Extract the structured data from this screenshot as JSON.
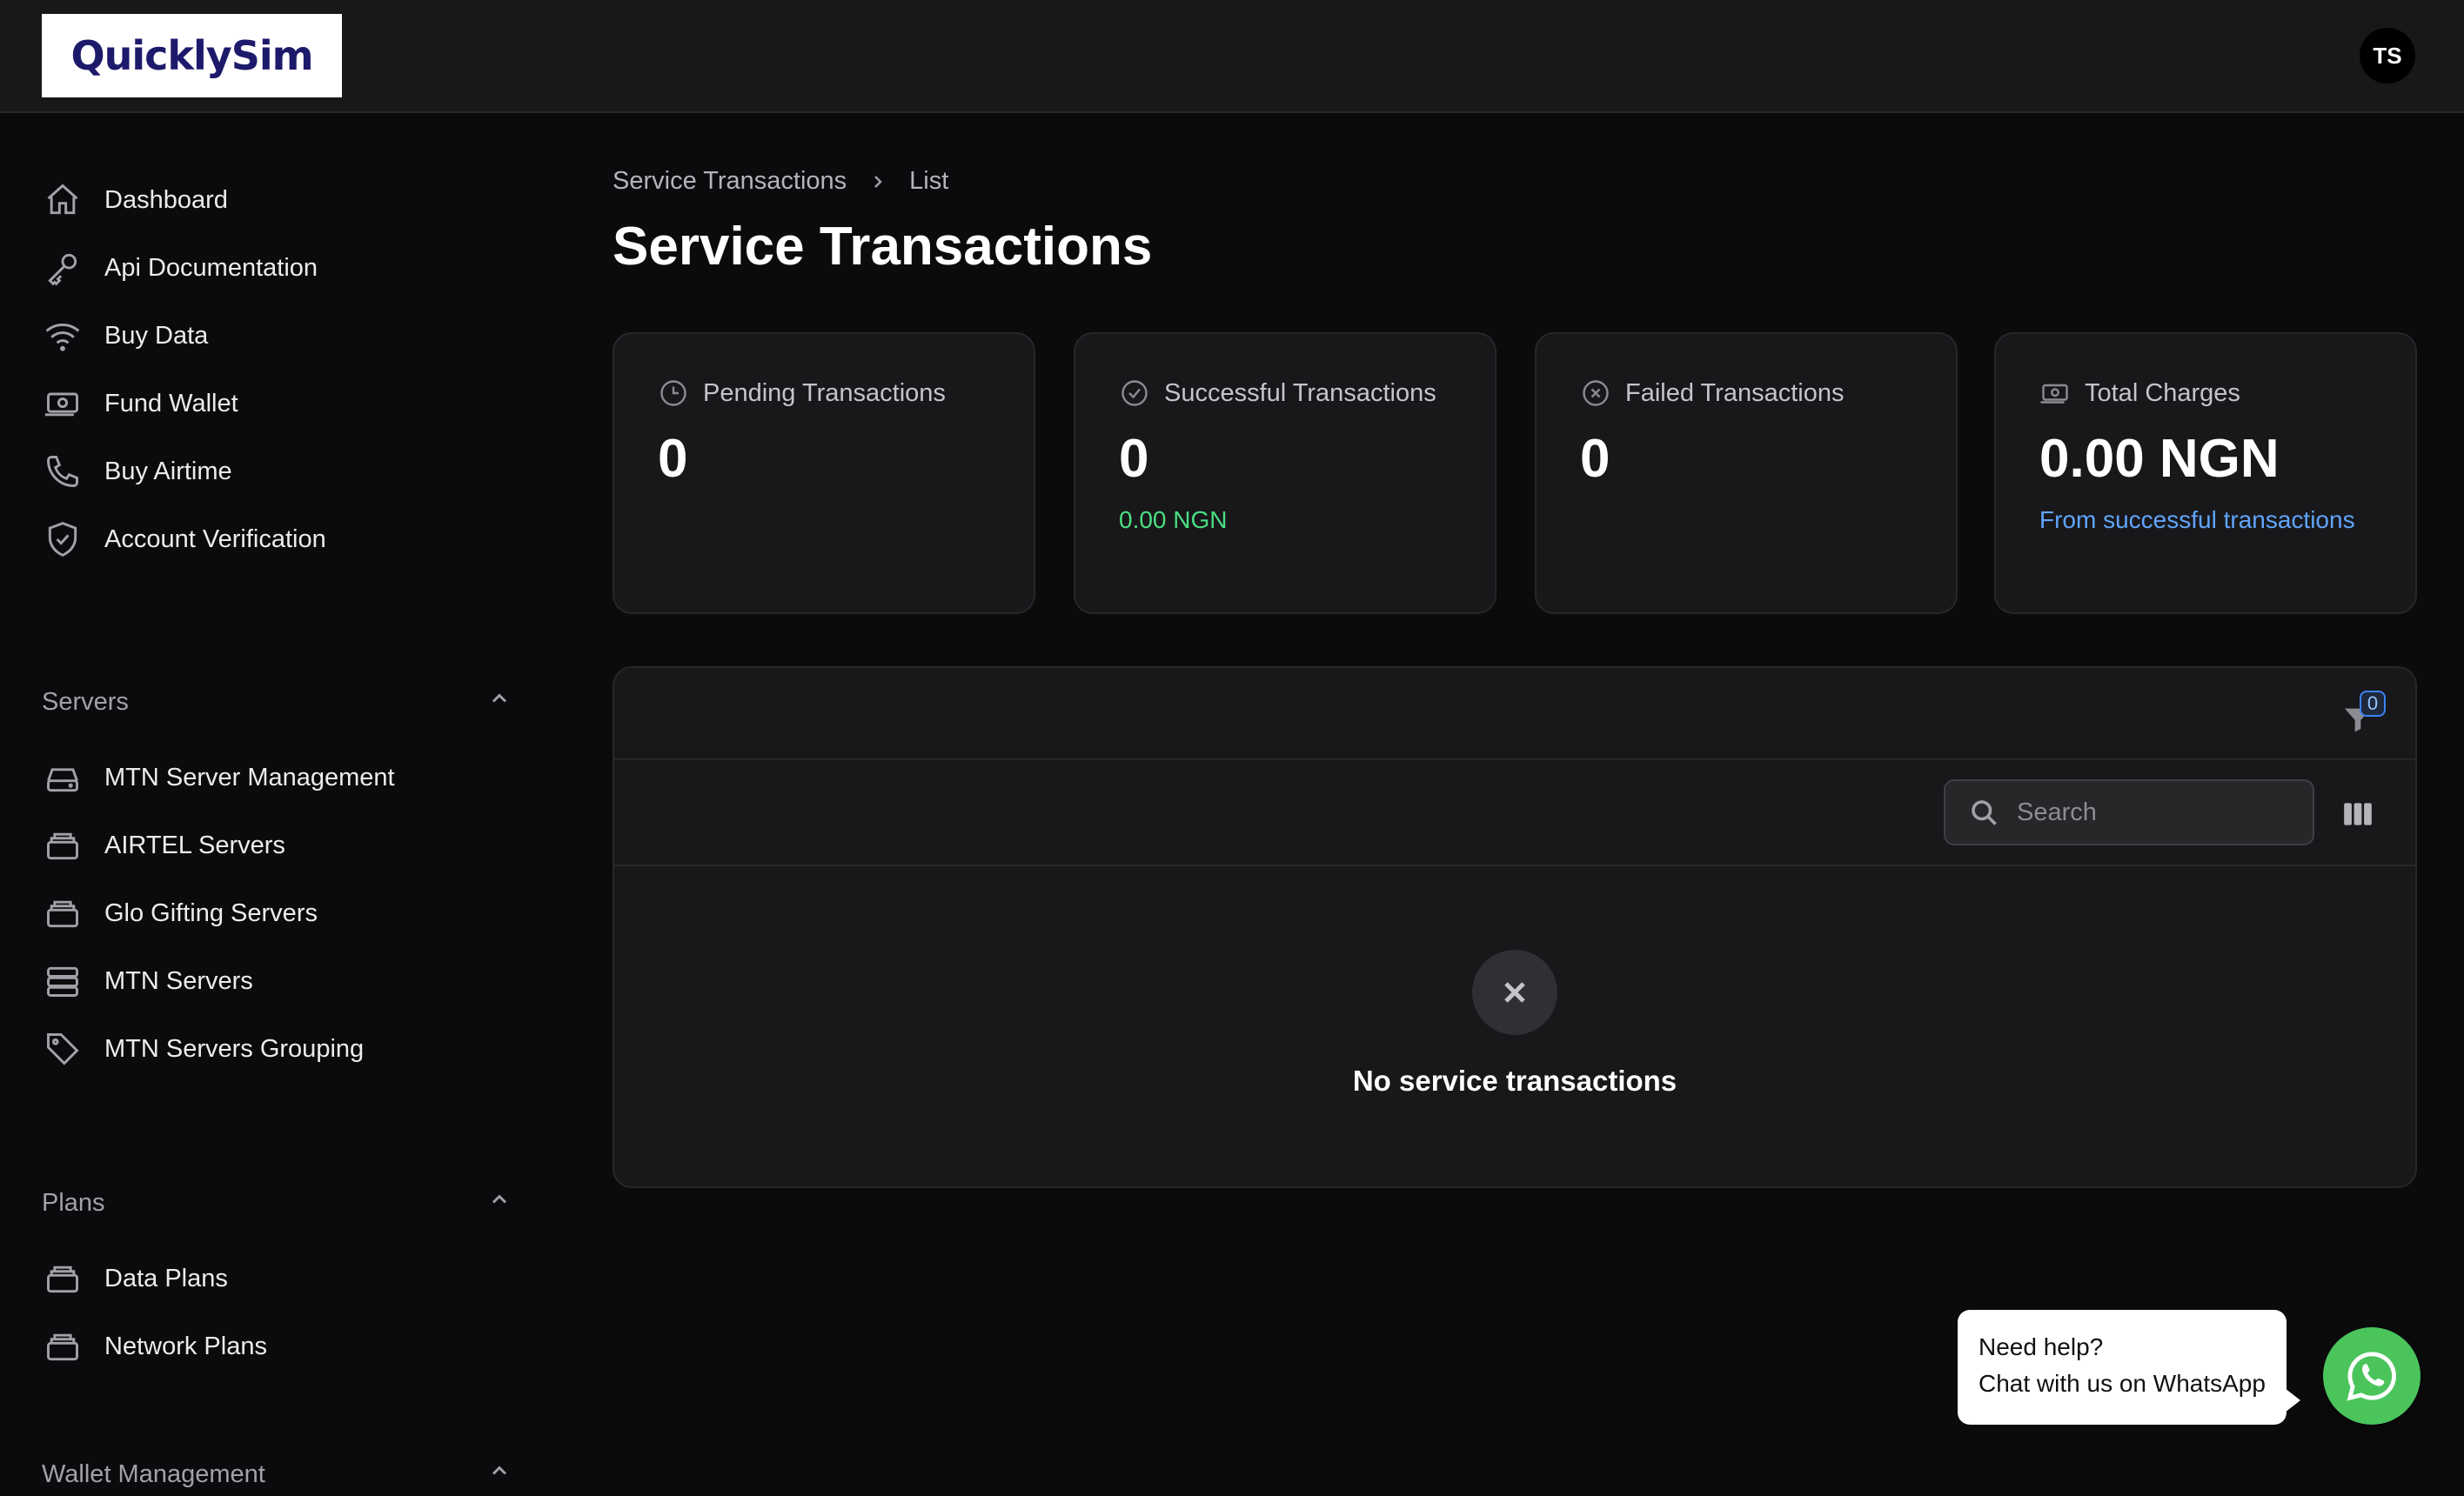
{
  "app": {
    "logo_text": "QuicklySim",
    "avatar_initials": "TS"
  },
  "sidebar": {
    "items": [
      {
        "label": "Dashboard",
        "icon": "home-icon"
      },
      {
        "label": "Api Documentation",
        "icon": "key-icon"
      },
      {
        "label": "Buy Data",
        "icon": "wifi-icon"
      },
      {
        "label": "Fund Wallet",
        "icon": "banknote-icon"
      },
      {
        "label": "Buy Airtime",
        "icon": "phone-icon"
      },
      {
        "label": "Account Verification",
        "icon": "shield-check-icon"
      }
    ],
    "groups": [
      {
        "label": "Servers",
        "items": [
          {
            "label": "MTN Server Management",
            "icon": "server-icon"
          },
          {
            "label": "AIRTEL Servers",
            "icon": "stack-icon"
          },
          {
            "label": "Glo Gifting Servers",
            "icon": "stack-icon"
          },
          {
            "label": "MTN Servers",
            "icon": "server-stack-icon"
          },
          {
            "label": "MTN Servers Grouping",
            "icon": "tag-icon"
          }
        ]
      },
      {
        "label": "Plans",
        "items": [
          {
            "label": "Data Plans",
            "icon": "stack-icon"
          },
          {
            "label": "Network Plans",
            "icon": "stack-icon"
          }
        ]
      },
      {
        "label": "Wallet Management",
        "items": []
      }
    ]
  },
  "breadcrumb": {
    "parent": "Service Transactions",
    "current": "List"
  },
  "page": {
    "title": "Service Transactions"
  },
  "stats": [
    {
      "label": "Pending Transactions",
      "value": "0",
      "desc": "",
      "icon": "clock-icon"
    },
    {
      "label": "Successful Transactions",
      "value": "0",
      "desc": "0.00 NGN",
      "icon": "check-circle-icon"
    },
    {
      "label": "Failed Transactions",
      "value": "0",
      "desc": "",
      "icon": "x-circle-icon"
    },
    {
      "label": "Total Charges",
      "value": "0.00 NGN",
      "desc": "From successful transactions",
      "icon": "banknote-icon"
    }
  ],
  "table": {
    "filter_count": "0",
    "search_placeholder": "Search",
    "empty_message": "No service transactions"
  },
  "help": {
    "line1": "Need help?",
    "line2": "Chat with us on WhatsApp"
  },
  "colors": {
    "background": "#0b0b0d",
    "card": "#18181b",
    "success": "#4ade80",
    "link": "#60a5fa",
    "whatsapp": "#4bc45c"
  }
}
